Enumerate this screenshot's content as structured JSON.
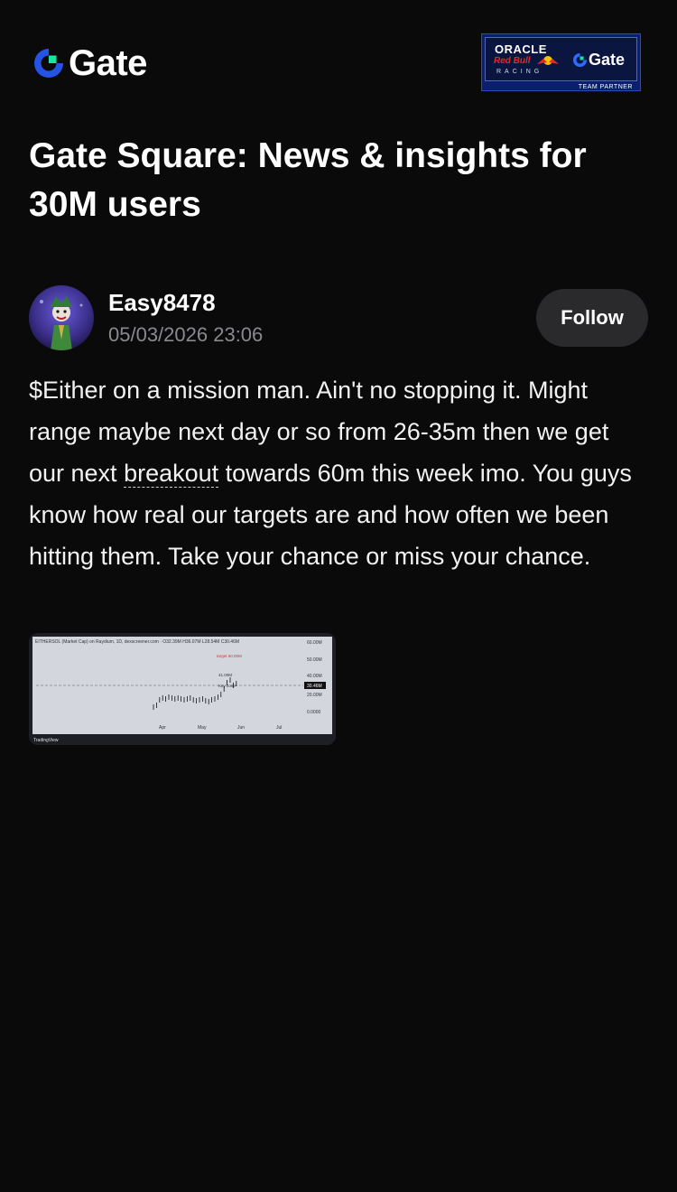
{
  "brand": {
    "name": "Gate",
    "accent": "#2354e6",
    "green": "#17e5a1"
  },
  "partner": {
    "oracle": "ORACLE",
    "redbull": "Red Bull",
    "racing": "RACING",
    "gate": "Gate",
    "team": "TEAM PARTNER"
  },
  "page": {
    "title": "Gate Square: News & insights for 30M users"
  },
  "post": {
    "author": "Easy8478",
    "datetime": "05/03/2026 23:06",
    "follow_label": "Follow",
    "body_before": "$Either on a mission man. Ain't no stopping it. Might range maybe next day or so from 26-35m then we get our next ",
    "body_link": "breakout",
    "body_after": " towards 60m this week imo. You guys know how real our targets are and how often we been hitting them. Take your chance or miss your chance."
  },
  "chart_thumbnail": {
    "header": "EITHERSOL (Market Cap) on Raydium, 1D, dexscreener.com · O32.39M H36.07M L28.54M C30.46M",
    "y_ticks": [
      "60.00M",
      "50.00M",
      "40.00M",
      "30.46M",
      "20.00M",
      "0.0000"
    ],
    "x_ticks": [
      "Apr",
      "May",
      "Jun",
      "Jul"
    ],
    "annotations": [
      "target 60.00M",
      "41.00M",
      "Key zone"
    ],
    "footer": "TradingView"
  }
}
